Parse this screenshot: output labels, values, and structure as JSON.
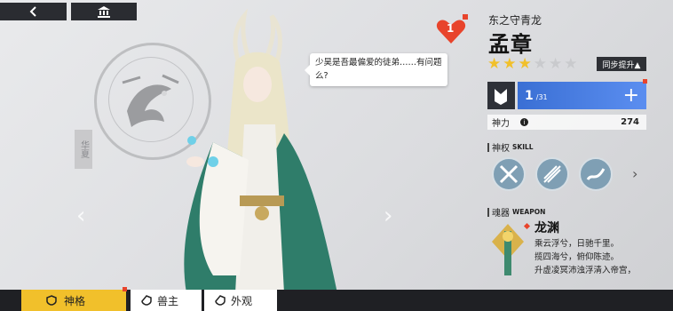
{
  "topbar": {
    "back_label": "‹",
    "home_icon": "temple-icon"
  },
  "emblem": {
    "seal_text": "华夏"
  },
  "bubble": {
    "text": "少昊是吾最偏爱的徒弟……有问题么?"
  },
  "heart": {
    "count": "1"
  },
  "hero": {
    "subtitle": "东之守青龙",
    "name": "孟章"
  },
  "stars": {
    "filled": 3,
    "total": 6
  },
  "sync_button": "同步提升▲",
  "level": {
    "current": "1",
    "max": "/31",
    "plus": "+"
  },
  "power": {
    "label": "神力",
    "value": "274"
  },
  "skills": {
    "title": "神权",
    "title_en": "SKILL"
  },
  "weapon": {
    "title": "魂器",
    "title_en": "WEAPON",
    "name": "龙渊",
    "desc": [
      "乘云浮兮，日驰千里。",
      "揽四海兮，俯仰陈迹。",
      "升虚凌冥沛浊浮清入帝宫，"
    ]
  },
  "tabs": [
    {
      "label": "神格",
      "active": true
    },
    {
      "label": "兽主",
      "active": false
    },
    {
      "label": "外观",
      "active": false
    }
  ],
  "colors": {
    "accent": "#f1c02b",
    "level_bar": "#4a7de2",
    "cloak": "#2f7d6a",
    "alert": "#e8442c"
  }
}
